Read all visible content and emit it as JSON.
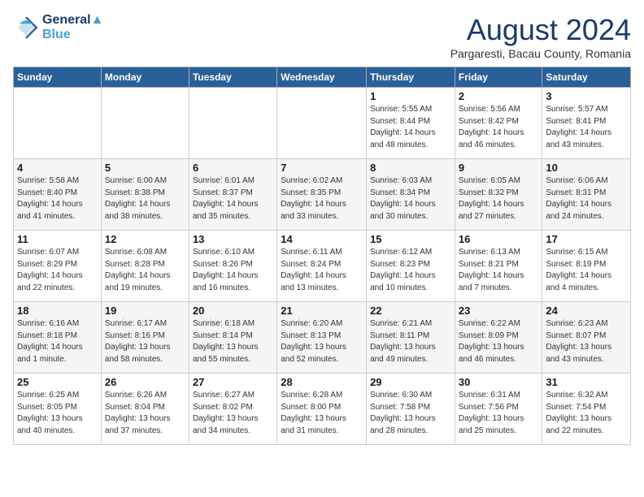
{
  "logo": {
    "line1": "General",
    "line2": "Blue"
  },
  "title": "August 2024",
  "location": "Pargaresti, Bacau County, Romania",
  "weekdays": [
    "Sunday",
    "Monday",
    "Tuesday",
    "Wednesday",
    "Thursday",
    "Friday",
    "Saturday"
  ],
  "weeks": [
    [
      {
        "day": "",
        "info": ""
      },
      {
        "day": "",
        "info": ""
      },
      {
        "day": "",
        "info": ""
      },
      {
        "day": "",
        "info": ""
      },
      {
        "day": "1",
        "info": "Sunrise: 5:55 AM\nSunset: 8:44 PM\nDaylight: 14 hours\nand 48 minutes."
      },
      {
        "day": "2",
        "info": "Sunrise: 5:56 AM\nSunset: 8:42 PM\nDaylight: 14 hours\nand 46 minutes."
      },
      {
        "day": "3",
        "info": "Sunrise: 5:57 AM\nSunset: 8:41 PM\nDaylight: 14 hours\nand 43 minutes."
      }
    ],
    [
      {
        "day": "4",
        "info": "Sunrise: 5:58 AM\nSunset: 8:40 PM\nDaylight: 14 hours\nand 41 minutes."
      },
      {
        "day": "5",
        "info": "Sunrise: 6:00 AM\nSunset: 8:38 PM\nDaylight: 14 hours\nand 38 minutes."
      },
      {
        "day": "6",
        "info": "Sunrise: 6:01 AM\nSunset: 8:37 PM\nDaylight: 14 hours\nand 35 minutes."
      },
      {
        "day": "7",
        "info": "Sunrise: 6:02 AM\nSunset: 8:35 PM\nDaylight: 14 hours\nand 33 minutes."
      },
      {
        "day": "8",
        "info": "Sunrise: 6:03 AM\nSunset: 8:34 PM\nDaylight: 14 hours\nand 30 minutes."
      },
      {
        "day": "9",
        "info": "Sunrise: 6:05 AM\nSunset: 8:32 PM\nDaylight: 14 hours\nand 27 minutes."
      },
      {
        "day": "10",
        "info": "Sunrise: 6:06 AM\nSunset: 8:31 PM\nDaylight: 14 hours\nand 24 minutes."
      }
    ],
    [
      {
        "day": "11",
        "info": "Sunrise: 6:07 AM\nSunset: 8:29 PM\nDaylight: 14 hours\nand 22 minutes."
      },
      {
        "day": "12",
        "info": "Sunrise: 6:08 AM\nSunset: 8:28 PM\nDaylight: 14 hours\nand 19 minutes."
      },
      {
        "day": "13",
        "info": "Sunrise: 6:10 AM\nSunset: 8:26 PM\nDaylight: 14 hours\nand 16 minutes."
      },
      {
        "day": "14",
        "info": "Sunrise: 6:11 AM\nSunset: 8:24 PM\nDaylight: 14 hours\nand 13 minutes."
      },
      {
        "day": "15",
        "info": "Sunrise: 6:12 AM\nSunset: 8:23 PM\nDaylight: 14 hours\nand 10 minutes."
      },
      {
        "day": "16",
        "info": "Sunrise: 6:13 AM\nSunset: 8:21 PM\nDaylight: 14 hours\nand 7 minutes."
      },
      {
        "day": "17",
        "info": "Sunrise: 6:15 AM\nSunset: 8:19 PM\nDaylight: 14 hours\nand 4 minutes."
      }
    ],
    [
      {
        "day": "18",
        "info": "Sunrise: 6:16 AM\nSunset: 8:18 PM\nDaylight: 14 hours\nand 1 minute."
      },
      {
        "day": "19",
        "info": "Sunrise: 6:17 AM\nSunset: 8:16 PM\nDaylight: 13 hours\nand 58 minutes."
      },
      {
        "day": "20",
        "info": "Sunrise: 6:18 AM\nSunset: 8:14 PM\nDaylight: 13 hours\nand 55 minutes."
      },
      {
        "day": "21",
        "info": "Sunrise: 6:20 AM\nSunset: 8:13 PM\nDaylight: 13 hours\nand 52 minutes."
      },
      {
        "day": "22",
        "info": "Sunrise: 6:21 AM\nSunset: 8:11 PM\nDaylight: 13 hours\nand 49 minutes."
      },
      {
        "day": "23",
        "info": "Sunrise: 6:22 AM\nSunset: 8:09 PM\nDaylight: 13 hours\nand 46 minutes."
      },
      {
        "day": "24",
        "info": "Sunrise: 6:23 AM\nSunset: 8:07 PM\nDaylight: 13 hours\nand 43 minutes."
      }
    ],
    [
      {
        "day": "25",
        "info": "Sunrise: 6:25 AM\nSunset: 8:05 PM\nDaylight: 13 hours\nand 40 minutes."
      },
      {
        "day": "26",
        "info": "Sunrise: 6:26 AM\nSunset: 8:04 PM\nDaylight: 13 hours\nand 37 minutes."
      },
      {
        "day": "27",
        "info": "Sunrise: 6:27 AM\nSunset: 8:02 PM\nDaylight: 13 hours\nand 34 minutes."
      },
      {
        "day": "28",
        "info": "Sunrise: 6:28 AM\nSunset: 8:00 PM\nDaylight: 13 hours\nand 31 minutes."
      },
      {
        "day": "29",
        "info": "Sunrise: 6:30 AM\nSunset: 7:58 PM\nDaylight: 13 hours\nand 28 minutes."
      },
      {
        "day": "30",
        "info": "Sunrise: 6:31 AM\nSunset: 7:56 PM\nDaylight: 13 hours\nand 25 minutes."
      },
      {
        "day": "31",
        "info": "Sunrise: 6:32 AM\nSunset: 7:54 PM\nDaylight: 13 hours\nand 22 minutes."
      }
    ]
  ]
}
